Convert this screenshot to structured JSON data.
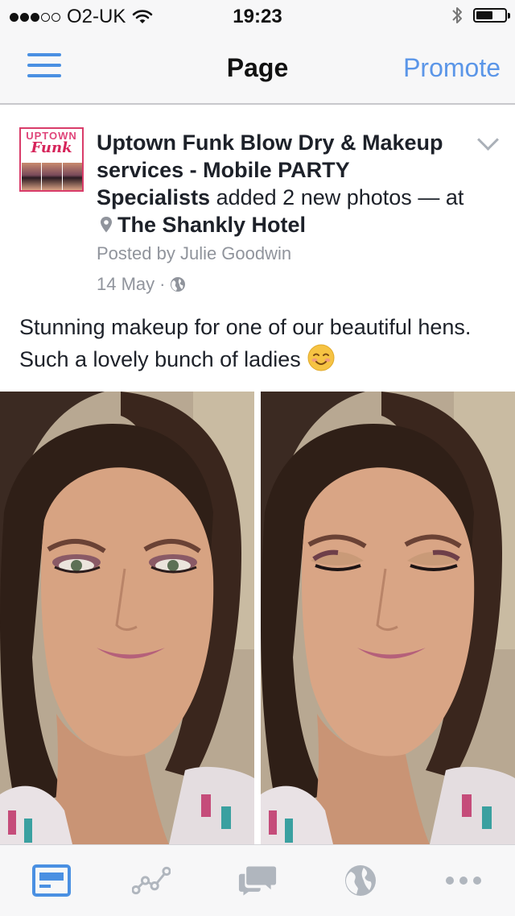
{
  "status_bar": {
    "carrier": "O2-UK",
    "time": "19:23",
    "signal_bars_filled": 3,
    "signal_bars_total": 5,
    "battery_level": 0.6,
    "icons": [
      "wifi-icon",
      "bluetooth-icon",
      "battery-icon"
    ]
  },
  "nav": {
    "menu_icon": "hamburger-icon",
    "title": "Page",
    "promote_label": "Promote"
  },
  "post": {
    "page_name": "Uptown Funk Blow Dry & Makeup services  - Mobile PARTY Specialists",
    "action": "added 2 new photos",
    "at_prefix": "— at",
    "location": "The Shankly Hotel",
    "posted_by": "Posted by Julie Goodwin",
    "date": "14 May",
    "separator": "·",
    "privacy_icon": "globe-icon",
    "text": "Stunning makeup for one of our beautiful hens. Such a lovely bunch of ladies",
    "emoji_icon": "smiling-face-icon",
    "avatar_logo": {
      "line1": "UPTOWN",
      "line2": "Funk"
    }
  },
  "tab_bar": {
    "tabs": [
      {
        "icon": "news-feed-icon",
        "active": true
      },
      {
        "icon": "insights-icon",
        "active": false
      },
      {
        "icon": "messages-icon",
        "active": false
      },
      {
        "icon": "globe-icon",
        "active": false
      },
      {
        "icon": "more-icon",
        "active": false
      }
    ]
  },
  "colors": {
    "accent": "#4a90e2",
    "inactive_icon": "#b0b6be",
    "secondary_text": "#90949c",
    "brand_pink": "#d6245a"
  }
}
